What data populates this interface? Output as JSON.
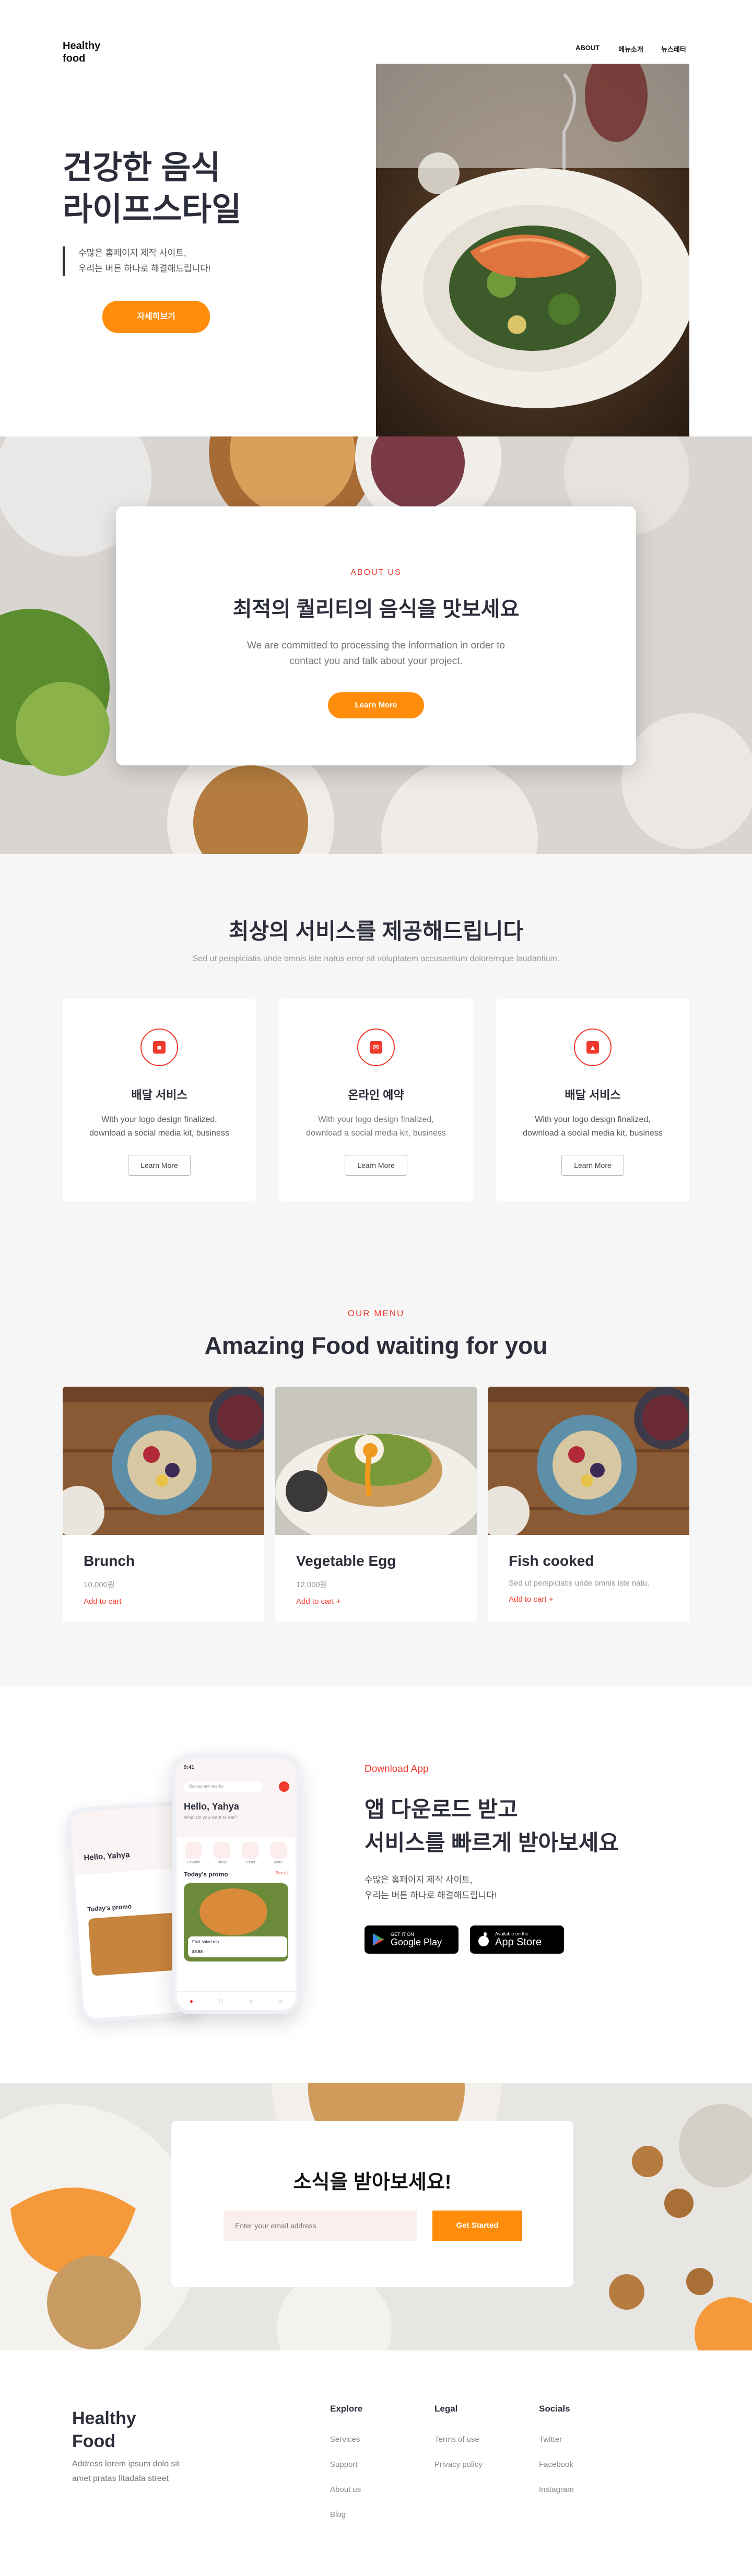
{
  "header": {
    "logo_line1": "Healthy",
    "logo_line2": "food",
    "nav": [
      "ABOUT",
      "메뉴소개",
      "뉴스레터"
    ]
  },
  "hero": {
    "title_line1": "건강한 음식",
    "title_line2": "라이프스타일",
    "desc_line1": "수많은 홈페이지 제작 사이트,",
    "desc_line2": "우리는 버튼 하나로 해결해드립니다!",
    "button": "자세히보기"
  },
  "about": {
    "kicker": "ABOUT US",
    "title": "최적의 퀄리티의 음식을 맛보세요",
    "text": "We are committed to processing the information in order to contact you and talk about your project.",
    "button": "Learn More"
  },
  "services": {
    "title": "최상의 서비스를 제공해드립니다",
    "subtitle": "Sed ut perspiciatis unde omnis iste natus error sit voluptatem accusantium doloremque laudantium.",
    "items": [
      {
        "title": "배달 서비스",
        "line1": "With your logo design finalized,",
        "line2": "download a social media kit, business",
        "button": "Learn More"
      },
      {
        "title": "온라인 예약",
        "line1": "With your logo design finalized,",
        "line2": "download a social media kit, business",
        "button": "Learn More"
      },
      {
        "title": "배달 서비스",
        "line1": "With your logo design finalized,",
        "line2": "download a social media kit, business",
        "button": "Learn More"
      }
    ]
  },
  "menu": {
    "kicker": "OUR MENU",
    "title": "Amazing Food waiting for you",
    "items": [
      {
        "name": "Brunch",
        "price": "10,000원",
        "cart": "Add to cart"
      },
      {
        "name": "Vegetable Egg",
        "price": "12,000원",
        "cart": "Add to cart +"
      },
      {
        "name": "Fish cooked",
        "price": "Sed ut perspiciatis unde omnis iste natu.",
        "cart": "Add to cart +"
      }
    ]
  },
  "app": {
    "kicker": "Download App",
    "title_line1": "앱 다운로드 받고",
    "title_line2": "서비스를 빠르게 받아보세요",
    "desc_line1": "수많은 홈페이지 제작 사이트,",
    "desc_line2": "우리는 버튼 하나로 해결해드립니다!",
    "google_small": "GET IT ON",
    "google_big": "Google Play",
    "apple_small": "Available on the",
    "apple_big": "App Store",
    "phone": {
      "time": "9:41",
      "search": "Restaurant nearby",
      "greeting": "Hello, Yahya",
      "question": "What do you want to eat?",
      "categories": [
        "Favorite",
        "Cheap",
        "Trend",
        "More"
      ],
      "promo": "Today's promo",
      "see_all": "See all",
      "promo_item": "Fruit salad mix",
      "promo_price": "$8.88"
    }
  },
  "newsletter": {
    "title": "소식을 받아보세요!",
    "placeholder": "Enter your email address",
    "button": "Get Started"
  },
  "footer": {
    "logo_line1": "Healthy",
    "logo_line2": "Food",
    "addr_line1": "Address lorem ipsum dolo sit",
    "addr_line2": "amet pratas Iltadala street",
    "explore": {
      "title": "Explore",
      "links": [
        "Services",
        "Support",
        "About us",
        "Blog"
      ]
    },
    "legal": {
      "title": "Legal",
      "links": [
        "Terms of use",
        "Privacy policy"
      ]
    },
    "socials": {
      "title": "Socials",
      "links": [
        "Twitter",
        "Facebook",
        "Instagram"
      ]
    }
  },
  "colors": {
    "accent": "#ff8c0a",
    "red": "#ef3b2d",
    "dark": "#2b2d3a"
  }
}
